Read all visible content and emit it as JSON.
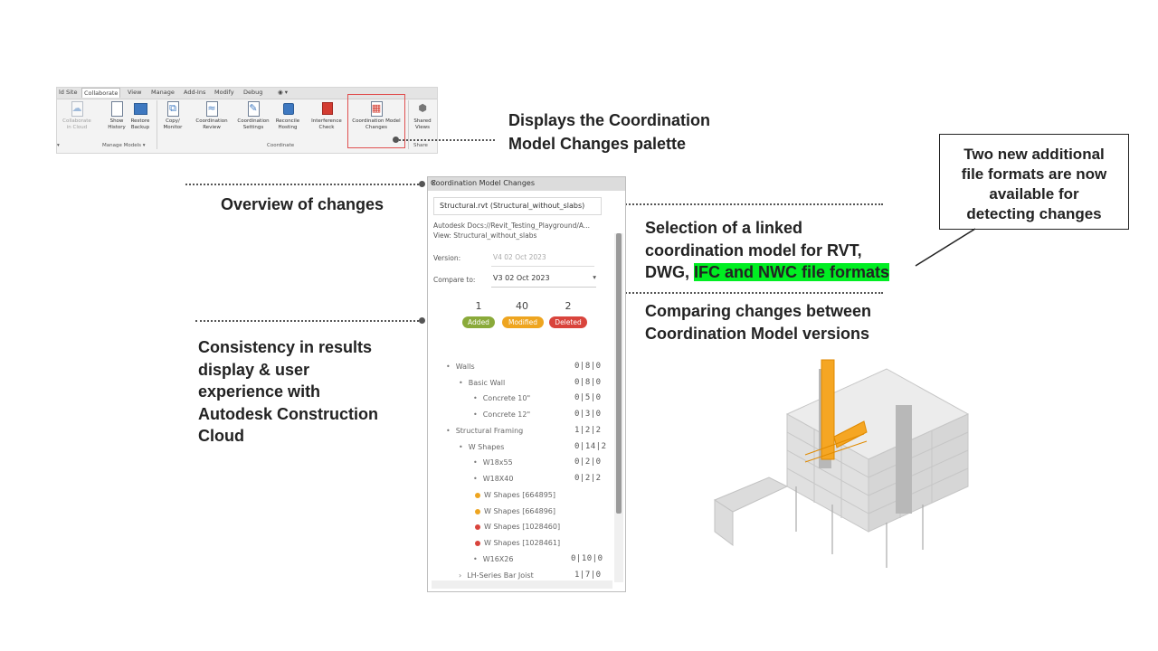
{
  "ribbon": {
    "tabs": [
      "ld Site",
      "Collaborate",
      "View",
      "Manage",
      "Add-Ins",
      "Modify",
      "Debug"
    ],
    "buttons": [
      {
        "label": "Collaborate\nin Cloud"
      },
      {
        "label": "Show\nHistory"
      },
      {
        "label": "Restore\nBackup"
      },
      {
        "label": "Copy/\nMonitor"
      },
      {
        "label": "Coordination\nReview"
      },
      {
        "label": "Coordination\nSettings"
      },
      {
        "label": "Reconcile\nHosting"
      },
      {
        "label": "Interference\nCheck"
      },
      {
        "label": "Coordination Model\nChanges"
      },
      {
        "label": "Shared\nViews"
      }
    ],
    "panels": [
      "Manage Models",
      "Coordinate",
      "Share"
    ]
  },
  "callouts": {
    "palette": "Displays the Coordination\nModel Changes palette",
    "overview": "Overview of changes",
    "selection_pre": "Selection of a linked\ncoordination model for RVT,\nDWG, ",
    "selection_hl": "IFC and NWC file formats",
    "comparing": "Comparing changes between\nCoordination Model versions",
    "consistency": "Consistency in results\ndisplay & user\nexperience with\nAutodesk Construction\nCloud"
  },
  "note": "Two new additional\nfile formats are now\navailable for\ndetecting changes",
  "palette": {
    "title": "Coordination Model Changes",
    "model": "Structural.rvt (Structural_without_slabs)",
    "path": "Autodesk Docs://Revit_Testing_Playground/A...",
    "view": "View: Structural_without_slabs",
    "version_label": "Version:",
    "version_value": "V4 02 Oct 2023",
    "compare_label": "Compare to:",
    "compare_value": "V3 02 Oct 2023",
    "counts": {
      "added": "1",
      "modified": "40",
      "deleted": "2"
    },
    "badges": {
      "added": "Added",
      "modified": "Modified",
      "deleted": "Deleted"
    },
    "tree": [
      {
        "label": "Walls",
        "counts": "0|8|0"
      },
      {
        "label": "Basic Wall",
        "counts": "0|8|0"
      },
      {
        "label": "Concrete 10\"",
        "counts": "0|5|0"
      },
      {
        "label": "Concrete 12\"",
        "counts": "0|3|0"
      },
      {
        "label": "Structural Framing",
        "counts": "1|2|2"
      },
      {
        "label": "W Shapes",
        "counts": "0|14|2"
      },
      {
        "label": "W18x55",
        "counts": "0|2|0"
      },
      {
        "label": "W18X40",
        "counts": "0|2|2"
      },
      {
        "label": "W Shapes [664895]",
        "counts": ""
      },
      {
        "label": "W Shapes [664896]",
        "counts": ""
      },
      {
        "label": "W Shapes [1028460]",
        "counts": ""
      },
      {
        "label": "W Shapes [1028461]",
        "counts": ""
      },
      {
        "label": "W16X26",
        "counts": "0|10|0"
      },
      {
        "label": "LH-Series Bar Joist",
        "counts": "1|7|0"
      }
    ]
  },
  "colors": {
    "added": "#8aaa3a",
    "modified": "#eea520",
    "deleted": "#d9443c",
    "highlight": "#00ee22",
    "model_accent": "#f5a623"
  }
}
